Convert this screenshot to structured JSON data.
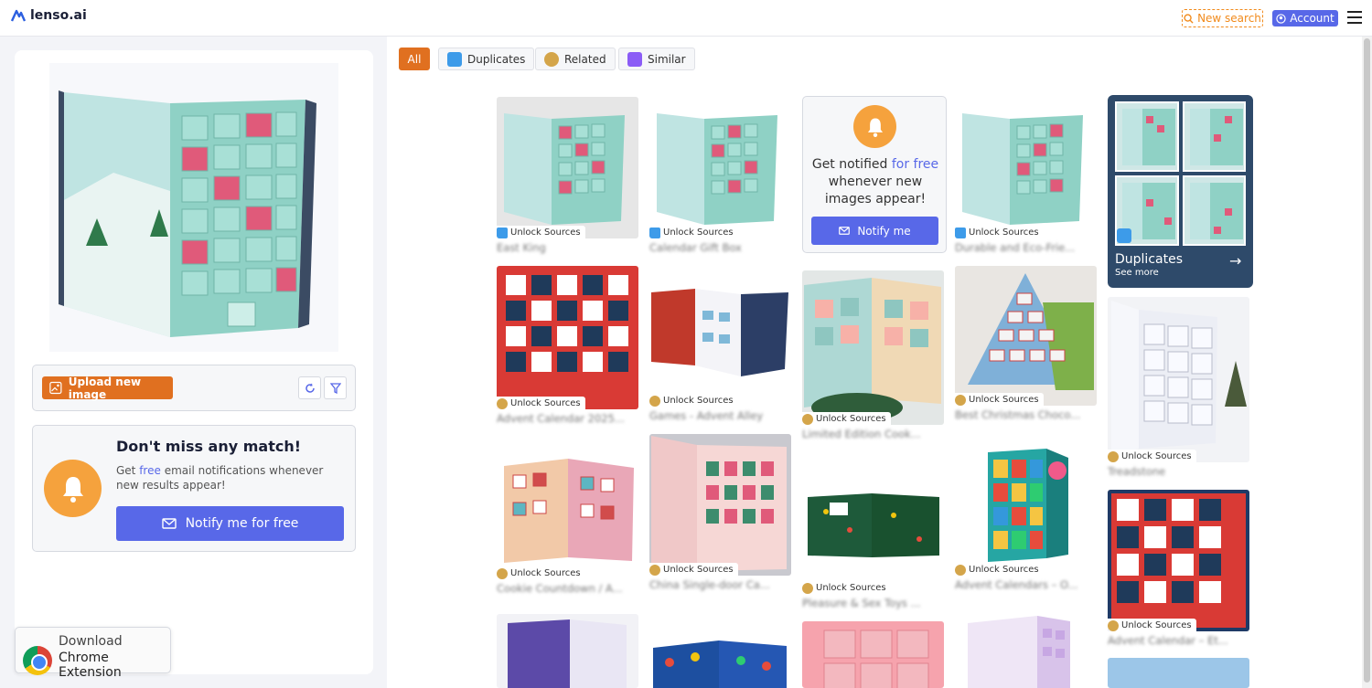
{
  "header": {
    "logo_text": "lenso.ai",
    "new_search": "New search",
    "account": "Account"
  },
  "filters": [
    {
      "label": "All",
      "active": true,
      "icon": ""
    },
    {
      "label": "Duplicates",
      "active": false,
      "icon": "duplicates-icon"
    },
    {
      "label": "Related",
      "active": false,
      "icon": "related-icon"
    },
    {
      "label": "Similar",
      "active": false,
      "icon": "similar-icon"
    }
  ],
  "left_panel": {
    "upload_button": "Upload new image",
    "notify_title": "Don't miss any match!",
    "notify_text_pre": "Get ",
    "notify_text_free": "free",
    "notify_text_post": " email notifications whenever new results appear!",
    "notify_button": "Notify me for free",
    "chrome_line1": "Download",
    "chrome_line2": "Chrome Extension"
  },
  "ad_card": {
    "text_pre": "Get notified ",
    "text_free": "for free",
    "text_post": " whenever new images appear!",
    "button": "Notify me"
  },
  "duplicates_card": {
    "title": "Duplicates",
    "see_more": "See more"
  },
  "unlock_label": "Unlock Sources",
  "colors": {
    "accent_orange": "#e07020",
    "accent_blue": "#5868e8",
    "duplicates_blue": "#3d9be9",
    "related_gold": "#d4a54a",
    "similar_purple": "#8b5cf6"
  },
  "results": [
    {
      "title": "East King",
      "type": "duplicate"
    },
    {
      "title": "Calendar Gift Box",
      "type": "duplicate"
    },
    {
      "title": "Durable and Eco-Frie...",
      "type": "duplicate"
    },
    {
      "title": "Advent Calendar 2025...",
      "type": "related"
    },
    {
      "title": "Games - Advent Alley",
      "type": "related"
    },
    {
      "title": "Limited Edition Cook...",
      "type": "related"
    },
    {
      "title": "Best Christmas Choco...",
      "type": "related"
    },
    {
      "title": "Treadstone",
      "type": "related"
    },
    {
      "title": "Cookie Countdown / A...",
      "type": "related"
    },
    {
      "title": "China Single-door Ca...",
      "type": "related"
    },
    {
      "title": "Pleasure & Sex Toys ...",
      "type": "related"
    },
    {
      "title": "Advent Calendars – O...",
      "type": "related"
    },
    {
      "title": "Advent Calendar – Et...",
      "type": "related"
    }
  ]
}
